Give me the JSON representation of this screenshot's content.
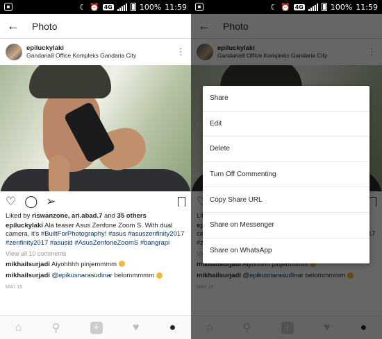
{
  "status_bar": {
    "battery": "100%",
    "time": "11:59",
    "network": "4G"
  },
  "header": {
    "title": "Photo"
  },
  "post": {
    "username": "epiluckylaki",
    "location": "Gandaria8 Office Kompleks Gandaria City",
    "likes_prefix": "Liked by ",
    "likes_users": "riswanzone, ari.abad.7",
    "likes_suffix": " and ",
    "likes_others": "35 others",
    "caption_user": "epiluckylaki",
    "caption_text": " Ala teaser Asus Zenfone Zoom S. With dual camera, it's ",
    "caption_tag1": "#BuiltForPhotography!",
    "caption_space": " ",
    "caption_tag2": "#asus",
    "caption_tag3": "#asuszenfinity2017",
    "caption_tag4": "#zenfinity2017",
    "caption_tag5": "#asusid",
    "caption_tag6": "#AsusZenfoneZoomS",
    "caption_tag7": "#bangrapi",
    "view_all": "View all 10 comments",
    "comments": [
      {
        "user": "mikhailsurjadi",
        "text": " Aiyohhhh pinjemmmm"
      },
      {
        "user": "mikhailsurjadi",
        "mention": "@epikusnarasudinar",
        "text": " belommmmm"
      }
    ],
    "date": "MAY 15"
  },
  "menu": {
    "items": [
      "Share",
      "Edit",
      "Delete",
      "Turn Off Commenting",
      "Copy Share URL",
      "Share on Messenger",
      "Share on WhatsApp"
    ]
  },
  "icons": {
    "back": "arrow-left-icon",
    "more": "more-vertical-icon",
    "heart": "heart-icon",
    "comment": "comment-icon",
    "share": "send-icon",
    "bookmark": "bookmark-icon",
    "home": "home-icon",
    "search": "search-icon",
    "add": "plus-icon",
    "activity": "heart-icon",
    "profile": "profile-icon"
  }
}
